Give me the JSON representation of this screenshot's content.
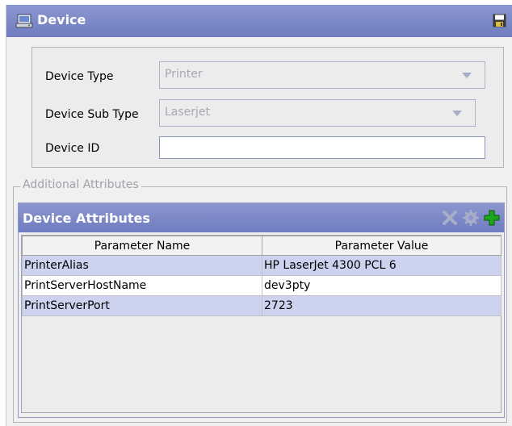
{
  "window": {
    "title": "Device"
  },
  "form": {
    "device_type_label": "Device Type",
    "device_type_value": "Printer",
    "device_sub_type_label": "Device Sub Type",
    "device_sub_type_value": "Laserjet",
    "device_id_label": "Device ID",
    "device_id_value": ""
  },
  "additional": {
    "legend": "Additional Attributes",
    "panel_title": "Device Attributes",
    "buttons": [
      "delete-icon",
      "gear-icon",
      "add-icon"
    ],
    "columns": [
      "Parameter Name",
      "Parameter Value"
    ],
    "rows": [
      [
        "PrinterAlias",
        "HP LaserJet 4300 PCL 6"
      ],
      [
        "PrintServerHostName",
        "dev3pty"
      ],
      [
        "PrintServerPort",
        "2723"
      ]
    ]
  },
  "colors": {
    "header_blue": "#7a86c6",
    "row_alt": "#cdd2ee",
    "add_green": "#1aa81a"
  }
}
